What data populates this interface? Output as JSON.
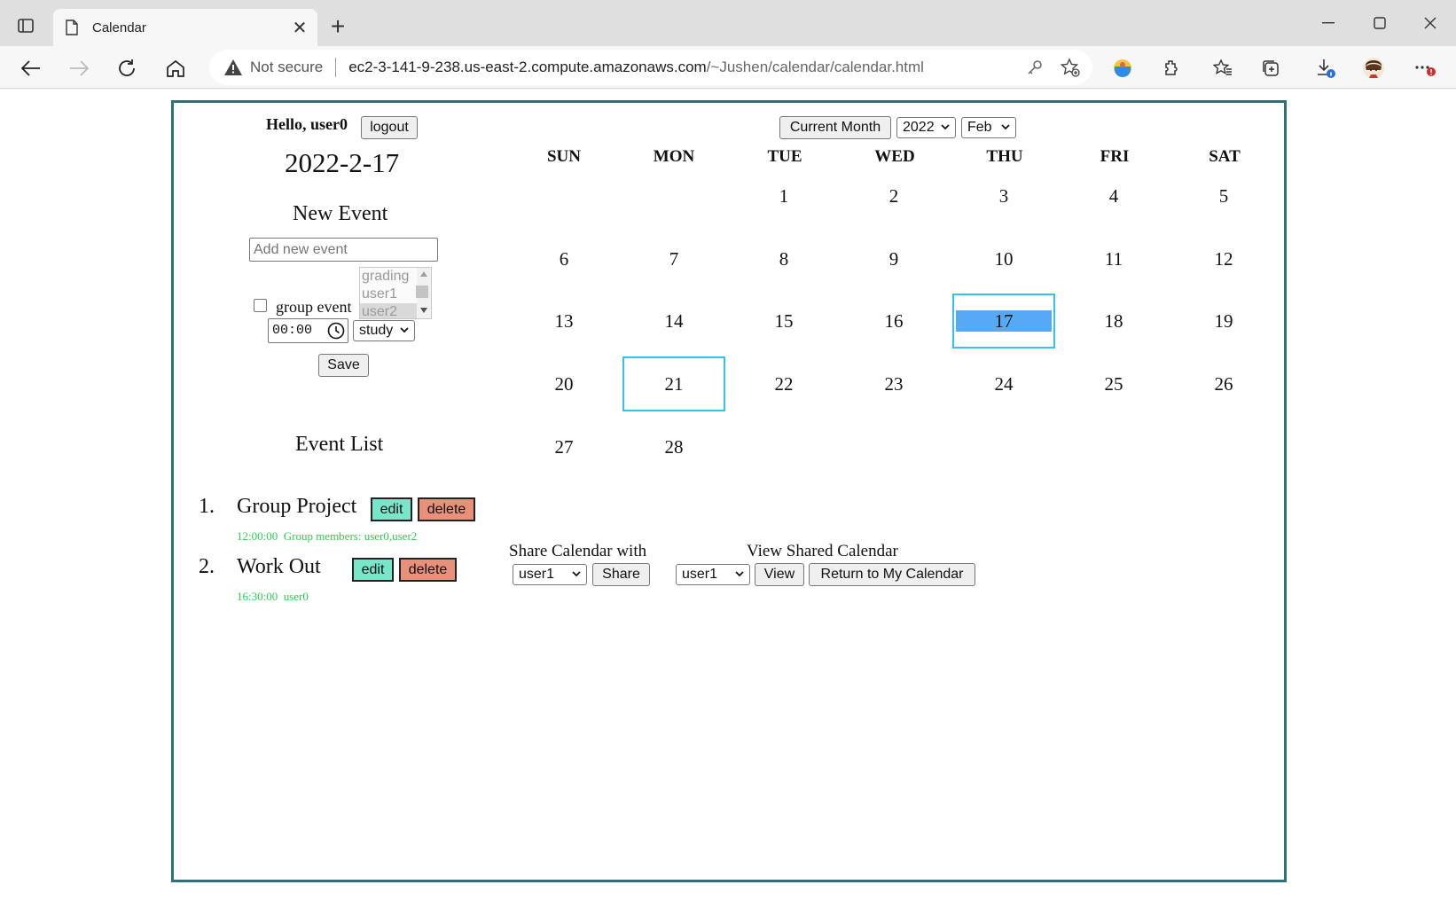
{
  "browser": {
    "tab_title": "Calendar",
    "new_tab_symbol": "+",
    "close_symbol": "✕",
    "security_label": "Not secure",
    "url_host": "ec2-3-141-9-238.us-east-2.compute.amazonaws.com",
    "url_path": "/~Jushen/calendar/calendar.html"
  },
  "sidebar": {
    "greeting": "Hello, user0",
    "logout_label": "logout",
    "today_date": "2022-2-17",
    "new_event_title": "New Event",
    "event_placeholder": "Add new event",
    "group_event_label": "group event",
    "group_members_options": [
      "grading",
      "user1",
      "user2"
    ],
    "time_value": "00:00",
    "category_value": "study",
    "save_label": "Save",
    "event_list_title": "Event List"
  },
  "events": [
    {
      "num": "1.",
      "title": "Group Project",
      "edit_label": "edit",
      "delete_label": "delete",
      "meta": "12:00:00  Group members: user0,user2"
    },
    {
      "num": "2.",
      "title": "Work Out",
      "edit_label": "edit",
      "delete_label": "delete",
      "meta": "16:30:00  user0"
    }
  ],
  "calendar": {
    "current_month_label": "Current Month",
    "year_value": "2022",
    "month_value": "Feb",
    "weekdays": [
      "SUN",
      "MON",
      "TUE",
      "WED",
      "THU",
      "FRI",
      "SAT"
    ],
    "weeks": [
      [
        "",
        "",
        "1",
        "2",
        "3",
        "4",
        "5"
      ],
      [
        "6",
        "7",
        "8",
        "9",
        "10",
        "11",
        "12"
      ],
      [
        "13",
        "14",
        "15",
        "16",
        "17",
        "18",
        "19"
      ],
      [
        "20",
        "21",
        "22",
        "23",
        "24",
        "25",
        "26"
      ],
      [
        "27",
        "28",
        "",
        "",
        "",
        "",
        ""
      ]
    ],
    "selected_day": "17",
    "outlined_day": "21",
    "highlight_color": "#55a9f5",
    "outline_color": "#35c3ea"
  },
  "share": {
    "share_title": "Share Calendar with",
    "share_user_value": "user1",
    "share_button": "Share",
    "view_title": "View Shared Calendar",
    "view_user_value": "user1",
    "view_button": "View",
    "return_button": "Return to My Calendar"
  },
  "colors": {
    "edit_button": "#78e6c8",
    "delete_button": "#e8907a",
    "event_meta_text": "#2ecc52",
    "frame_border": "#2f6f77"
  }
}
